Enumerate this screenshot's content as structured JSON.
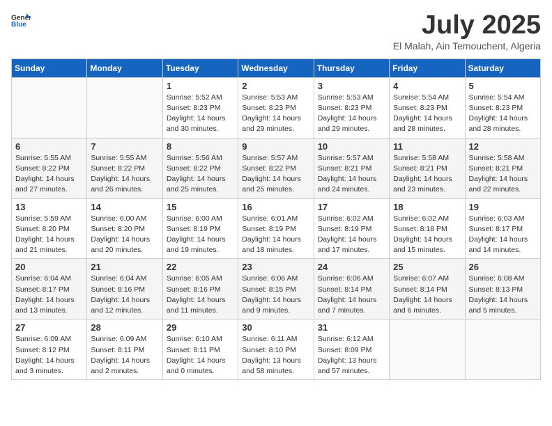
{
  "logo": {
    "general": "General",
    "blue": "Blue"
  },
  "title": "July 2025",
  "subtitle": "El Malah, Ain Temouchent, Algeria",
  "weekdays": [
    "Sunday",
    "Monday",
    "Tuesday",
    "Wednesday",
    "Thursday",
    "Friday",
    "Saturday"
  ],
  "weeks": [
    [
      {
        "day": "",
        "info": ""
      },
      {
        "day": "",
        "info": ""
      },
      {
        "day": "1",
        "info": "Sunrise: 5:52 AM\nSunset: 8:23 PM\nDaylight: 14 hours and 30 minutes."
      },
      {
        "day": "2",
        "info": "Sunrise: 5:53 AM\nSunset: 8:23 PM\nDaylight: 14 hours and 29 minutes."
      },
      {
        "day": "3",
        "info": "Sunrise: 5:53 AM\nSunset: 8:23 PM\nDaylight: 14 hours and 29 minutes."
      },
      {
        "day": "4",
        "info": "Sunrise: 5:54 AM\nSunset: 8:23 PM\nDaylight: 14 hours and 28 minutes."
      },
      {
        "day": "5",
        "info": "Sunrise: 5:54 AM\nSunset: 8:23 PM\nDaylight: 14 hours and 28 minutes."
      }
    ],
    [
      {
        "day": "6",
        "info": "Sunrise: 5:55 AM\nSunset: 8:22 PM\nDaylight: 14 hours and 27 minutes."
      },
      {
        "day": "7",
        "info": "Sunrise: 5:55 AM\nSunset: 8:22 PM\nDaylight: 14 hours and 26 minutes."
      },
      {
        "day": "8",
        "info": "Sunrise: 5:56 AM\nSunset: 8:22 PM\nDaylight: 14 hours and 25 minutes."
      },
      {
        "day": "9",
        "info": "Sunrise: 5:57 AM\nSunset: 8:22 PM\nDaylight: 14 hours and 25 minutes."
      },
      {
        "day": "10",
        "info": "Sunrise: 5:57 AM\nSunset: 8:21 PM\nDaylight: 14 hours and 24 minutes."
      },
      {
        "day": "11",
        "info": "Sunrise: 5:58 AM\nSunset: 8:21 PM\nDaylight: 14 hours and 23 minutes."
      },
      {
        "day": "12",
        "info": "Sunrise: 5:58 AM\nSunset: 8:21 PM\nDaylight: 14 hours and 22 minutes."
      }
    ],
    [
      {
        "day": "13",
        "info": "Sunrise: 5:59 AM\nSunset: 8:20 PM\nDaylight: 14 hours and 21 minutes."
      },
      {
        "day": "14",
        "info": "Sunrise: 6:00 AM\nSunset: 8:20 PM\nDaylight: 14 hours and 20 minutes."
      },
      {
        "day": "15",
        "info": "Sunrise: 6:00 AM\nSunset: 8:19 PM\nDaylight: 14 hours and 19 minutes."
      },
      {
        "day": "16",
        "info": "Sunrise: 6:01 AM\nSunset: 8:19 PM\nDaylight: 14 hours and 18 minutes."
      },
      {
        "day": "17",
        "info": "Sunrise: 6:02 AM\nSunset: 8:19 PM\nDaylight: 14 hours and 17 minutes."
      },
      {
        "day": "18",
        "info": "Sunrise: 6:02 AM\nSunset: 8:18 PM\nDaylight: 14 hours and 15 minutes."
      },
      {
        "day": "19",
        "info": "Sunrise: 6:03 AM\nSunset: 8:17 PM\nDaylight: 14 hours and 14 minutes."
      }
    ],
    [
      {
        "day": "20",
        "info": "Sunrise: 6:04 AM\nSunset: 8:17 PM\nDaylight: 14 hours and 13 minutes."
      },
      {
        "day": "21",
        "info": "Sunrise: 6:04 AM\nSunset: 8:16 PM\nDaylight: 14 hours and 12 minutes."
      },
      {
        "day": "22",
        "info": "Sunrise: 6:05 AM\nSunset: 8:16 PM\nDaylight: 14 hours and 11 minutes."
      },
      {
        "day": "23",
        "info": "Sunrise: 6:06 AM\nSunset: 8:15 PM\nDaylight: 14 hours and 9 minutes."
      },
      {
        "day": "24",
        "info": "Sunrise: 6:06 AM\nSunset: 8:14 PM\nDaylight: 14 hours and 7 minutes."
      },
      {
        "day": "25",
        "info": "Sunrise: 6:07 AM\nSunset: 8:14 PM\nDaylight: 14 hours and 6 minutes."
      },
      {
        "day": "26",
        "info": "Sunrise: 6:08 AM\nSunset: 8:13 PM\nDaylight: 14 hours and 5 minutes."
      }
    ],
    [
      {
        "day": "27",
        "info": "Sunrise: 6:09 AM\nSunset: 8:12 PM\nDaylight: 14 hours and 3 minutes."
      },
      {
        "day": "28",
        "info": "Sunrise: 6:09 AM\nSunset: 8:11 PM\nDaylight: 14 hours and 2 minutes."
      },
      {
        "day": "29",
        "info": "Sunrise: 6:10 AM\nSunset: 8:11 PM\nDaylight: 14 hours and 0 minutes."
      },
      {
        "day": "30",
        "info": "Sunrise: 6:11 AM\nSunset: 8:10 PM\nDaylight: 13 hours and 58 minutes."
      },
      {
        "day": "31",
        "info": "Sunrise: 6:12 AM\nSunset: 8:09 PM\nDaylight: 13 hours and 57 minutes."
      },
      {
        "day": "",
        "info": ""
      },
      {
        "day": "",
        "info": ""
      }
    ]
  ]
}
